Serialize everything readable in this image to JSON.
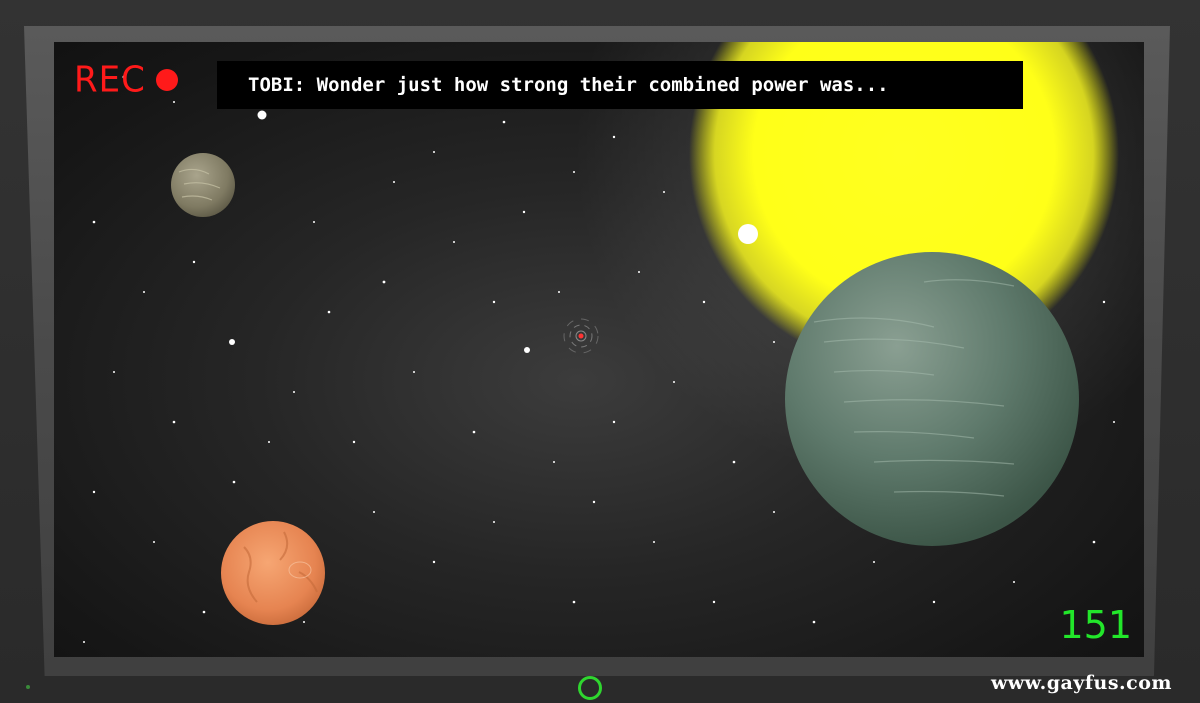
{
  "hud": {
    "rec_label": "REC",
    "rec_color": "#ff1a1a",
    "dialog_text": "TOBI: Wonder just how strong their combined power was...",
    "counter": "151",
    "counter_color": "#22e62a"
  },
  "device": {
    "power_button_color": "#2fd62f"
  },
  "watermark": "www.gayfus.com",
  "scene": {
    "sun_color": "#ffff1a",
    "planets": [
      "grey-brown-planet",
      "orange-planet",
      "green-gas-giant"
    ],
    "crosshair_color": "#ff3333"
  }
}
